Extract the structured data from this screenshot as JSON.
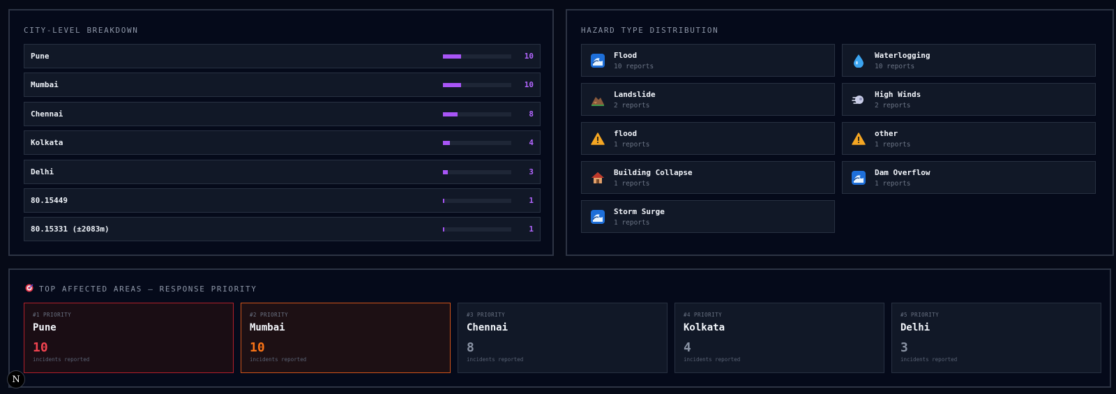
{
  "city_breakdown": {
    "title": "CITY-LEVEL BREAKDOWN",
    "max_count": 10,
    "rows": [
      {
        "city": "Pune",
        "count": "10",
        "fill_fraction": 0.27
      },
      {
        "city": "Mumbai",
        "count": "10",
        "fill_fraction": 0.27
      },
      {
        "city": "Chennai",
        "count": "8",
        "fill_fraction": 0.21
      },
      {
        "city": "Kolkata",
        "count": "4",
        "fill_fraction": 0.1
      },
      {
        "city": "Delhi",
        "count": "3",
        "fill_fraction": 0.07
      },
      {
        "city": "80.15449",
        "count": "1",
        "fill_fraction": 0.025
      },
      {
        "city": "80.15331 (±2083m)",
        "count": "1",
        "fill_fraction": 0.025
      }
    ]
  },
  "hazard_distribution": {
    "title": "HAZARD TYPE DISTRIBUTION",
    "items": [
      {
        "name": "Flood",
        "reports": "10 reports",
        "icon": "wave-icon"
      },
      {
        "name": "Waterlogging",
        "reports": "10 reports",
        "icon": "droplet-icon"
      },
      {
        "name": "Landslide",
        "reports": "2 reports",
        "icon": "landslide-icon"
      },
      {
        "name": "High Winds",
        "reports": "2 reports",
        "icon": "wind-icon"
      },
      {
        "name": "flood",
        "reports": "1 reports",
        "icon": "warning-icon"
      },
      {
        "name": "other",
        "reports": "1 reports",
        "icon": "warning-icon"
      },
      {
        "name": "Building Collapse",
        "reports": "1 reports",
        "icon": "house-icon"
      },
      {
        "name": "Dam Overflow",
        "reports": "1 reports",
        "icon": "wave-icon"
      },
      {
        "name": "Storm Surge",
        "reports": "1 reports",
        "icon": "wave-icon"
      }
    ]
  },
  "priority": {
    "title": "TOP AFFECTED AREAS — RESPONSE PRIORITY",
    "icon": "target-icon",
    "cards": [
      {
        "rank": "#1 PRIORITY",
        "city": "Pune",
        "count": "10",
        "label": "incidents reported"
      },
      {
        "rank": "#2 PRIORITY",
        "city": "Mumbai",
        "count": "10",
        "label": "incidents reported"
      },
      {
        "rank": "#3 PRIORITY",
        "city": "Chennai",
        "count": "8",
        "label": "incidents reported"
      },
      {
        "rank": "#4 PRIORITY",
        "city": "Kolkata",
        "count": "4",
        "label": "incidents reported"
      },
      {
        "rank": "#5 PRIORITY",
        "city": "Delhi",
        "count": "3",
        "label": "incidents reported"
      }
    ]
  },
  "dev_badge": {
    "label": "N"
  },
  "colors": {
    "accent_purple": "#a855f7",
    "priority_red": "#f0434f",
    "priority_orange": "#f97316"
  }
}
